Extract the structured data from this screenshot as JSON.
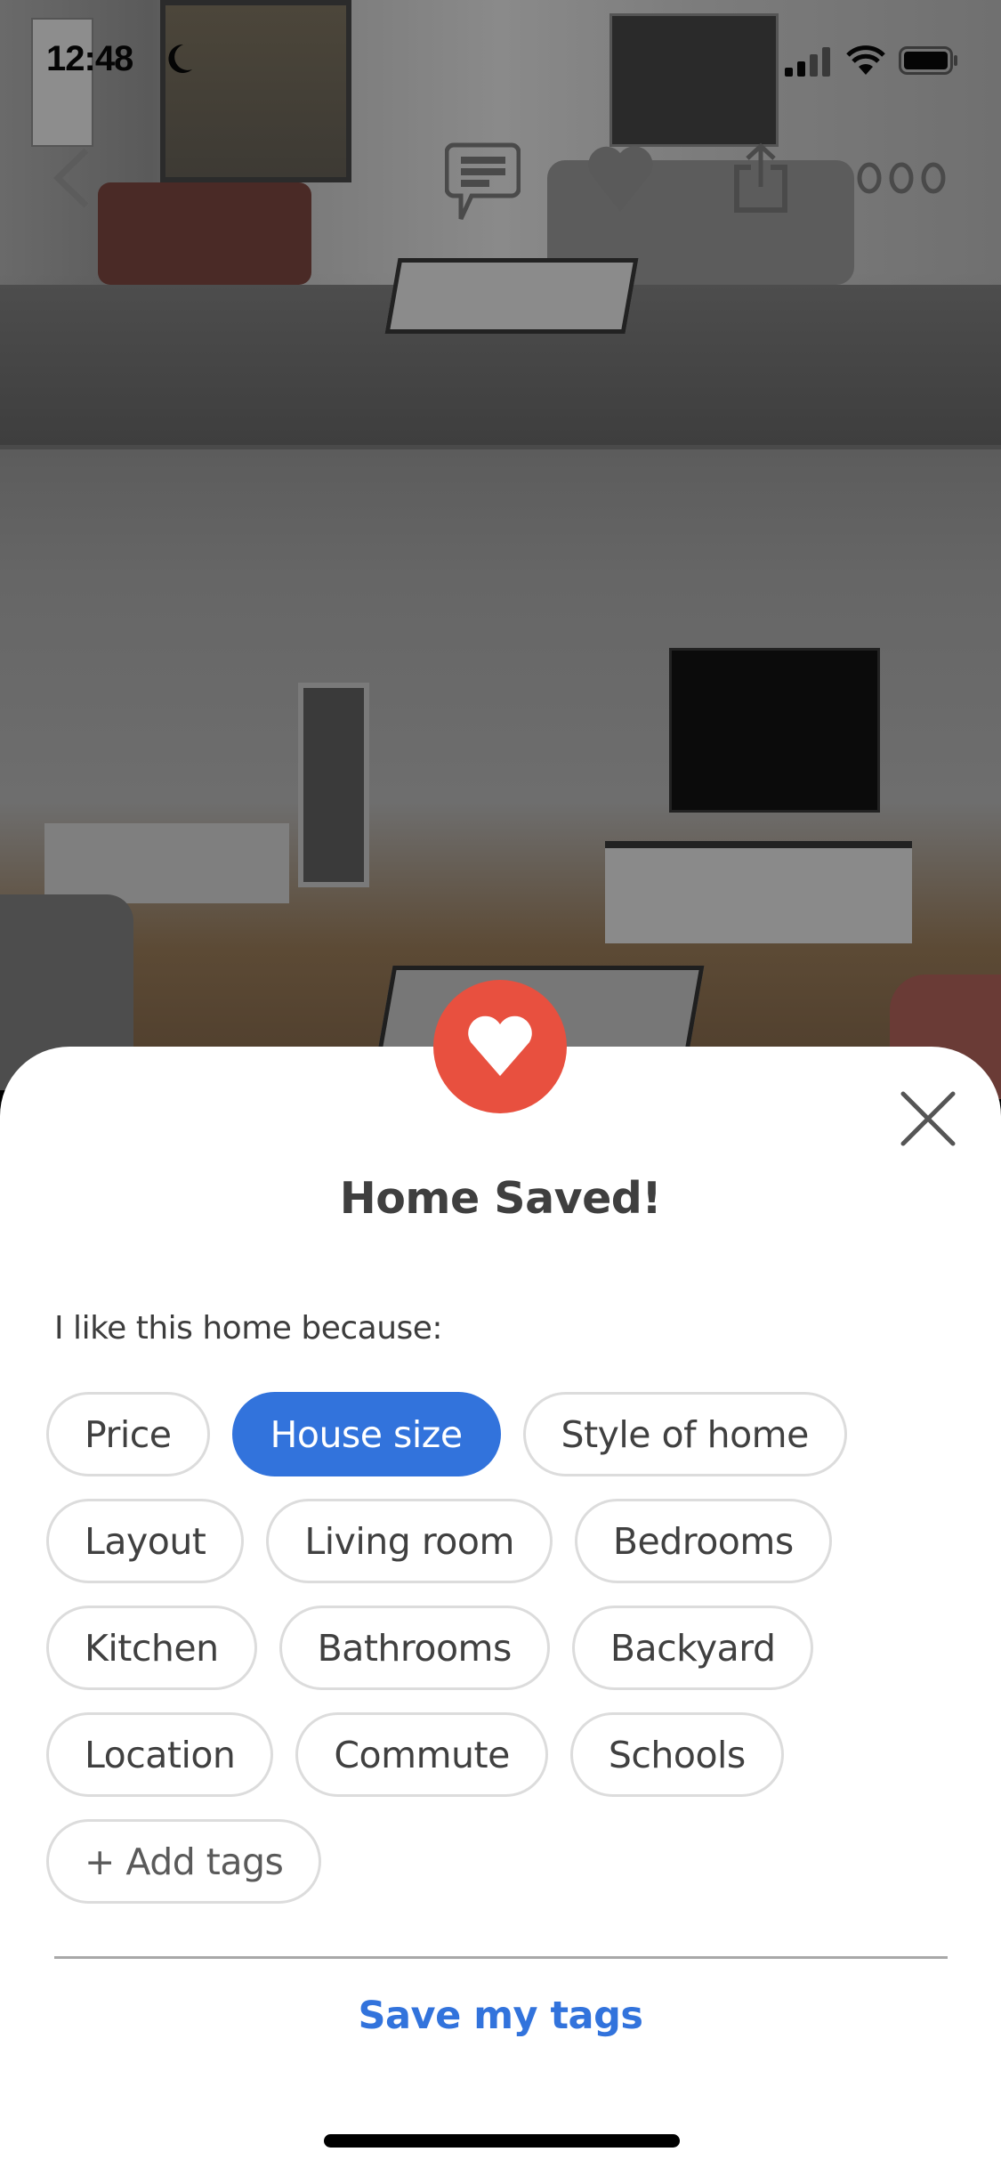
{
  "status_bar": {
    "time": "12:48",
    "focus_icon": "moon-icon",
    "signal_icon": "cellular-signal-icon",
    "wifi_icon": "wifi-icon",
    "battery_icon": "battery-icon"
  },
  "top_nav": {
    "icons": [
      "chevron-left-icon",
      "chat-icon",
      "heart-icon",
      "share-icon",
      "more-icon"
    ]
  },
  "sheet": {
    "badge_icon": "heart-icon",
    "title": "Home Saved!",
    "prompt": "I like this home because:",
    "tags": [
      {
        "label": "Price",
        "selected": false
      },
      {
        "label": "House size",
        "selected": true
      },
      {
        "label": "Style of home",
        "selected": false
      },
      {
        "label": "Layout",
        "selected": false
      },
      {
        "label": "Living room",
        "selected": false
      },
      {
        "label": "Bedrooms",
        "selected": false
      },
      {
        "label": "Kitchen",
        "selected": false
      },
      {
        "label": "Bathrooms",
        "selected": false
      },
      {
        "label": "Backyard",
        "selected": false
      },
      {
        "label": "Location",
        "selected": false
      },
      {
        "label": "Commute",
        "selected": false
      },
      {
        "label": "Schools",
        "selected": false
      }
    ],
    "add_tags_label": "+ Add tags",
    "save_label": "Save my tags"
  },
  "colors": {
    "accent_blue": "#3273dc",
    "heart_red": "#e8503f",
    "chip_border": "#dcdcdc",
    "text_dark": "#3f3f3f"
  }
}
